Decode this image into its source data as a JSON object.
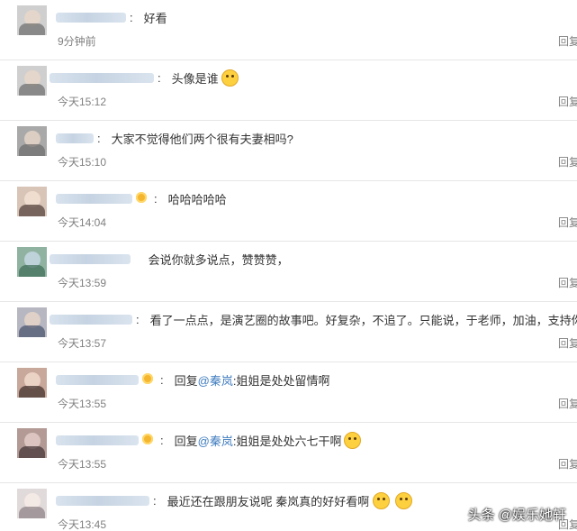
{
  "comments": [
    {
      "text": "好看",
      "time": "9分钟前",
      "reply": "回复",
      "emoji": false,
      "crown": false,
      "mention": ""
    },
    {
      "text": "头像是谁",
      "time": "今天15:12",
      "reply": "回复",
      "emoji": true,
      "crown": false,
      "mention": ""
    },
    {
      "text": "大家不觉得他们两个很有夫妻相吗?",
      "time": "今天15:10",
      "reply": "回复",
      "emoji": false,
      "crown": false,
      "mention": ""
    },
    {
      "text": "哈哈哈哈哈",
      "time": "今天14:04",
      "reply": "回复",
      "emoji": false,
      "crown": true,
      "mention": ""
    },
    {
      "text": "会说你就多说点，赞赞赞，",
      "time": "今天13:59",
      "reply": "回复",
      "emoji": false,
      "crown": false,
      "mention": ""
    },
    {
      "text": "看了一点点，是演艺圈的故事吧。好复杂，不追了。只能说，于老师，加油，支持你",
      "time": "今天13:57",
      "reply": "回复",
      "emoji": false,
      "crown": false,
      "mention": ""
    },
    {
      "text": "回复@秦岚:姐姐是处处留情啊",
      "text_prefix": "回复",
      "mention": "@秦岚",
      "text_rest": ":姐姐是处处留情啊",
      "time": "今天13:55",
      "reply": "回复",
      "emoji": false,
      "crown": true
    },
    {
      "text": "回复@秦岚:姐姐是处处六七干啊",
      "text_prefix": "回复",
      "mention": "@秦岚",
      "text_rest": ":姐姐是处处六七干啊",
      "time": "今天13:55",
      "reply": "回复",
      "emoji": true,
      "crown": true
    },
    {
      "text": "最近还在跟朋友说呢 秦岚真的好好看啊",
      "time": "今天13:45",
      "reply": "回复",
      "emoji": true,
      "emoji_count": 2,
      "crown": false,
      "mention": ""
    }
  ],
  "watermark": "头条 @娱乐她轩",
  "colors": {
    "mention": "#3f7cbf",
    "time": "#808080",
    "divider": "#e6e6e6",
    "emoji": "#fcd03f",
    "crown": "#f5b62f"
  },
  "icons": {
    "emoji": "laughing-face-icon",
    "crown": "crown-badge-icon"
  }
}
